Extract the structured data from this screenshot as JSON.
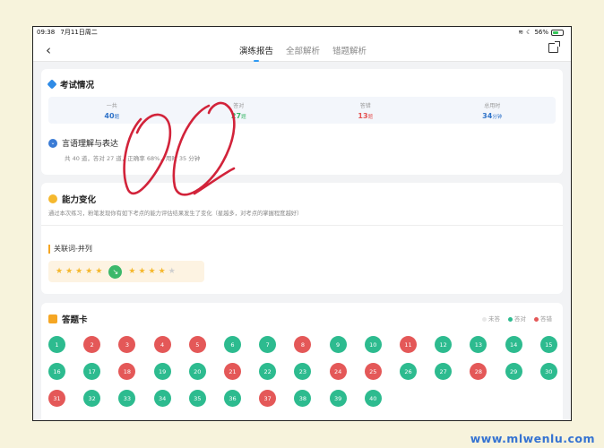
{
  "status": {
    "time": "09:38",
    "date": "7月11日周二",
    "battery": "56%",
    "battery_level": 0.56
  },
  "nav": {
    "back_glyph": "‹",
    "tabs": [
      {
        "label": "演练报告",
        "active": true
      },
      {
        "label": "全部解析",
        "active": false
      },
      {
        "label": "错题解析",
        "active": false
      }
    ]
  },
  "exam": {
    "title": "考试情况",
    "summary": [
      {
        "label": "一共",
        "value": "40",
        "unit": "题",
        "color": "#2f73c9"
      },
      {
        "label": "答对",
        "value": "27",
        "unit": "题",
        "color": "#3cb86a"
      },
      {
        "label": "答错",
        "value": "13",
        "unit": "题",
        "color": "#e45151"
      },
      {
        "label": "总用时",
        "value": "34",
        "unit": "分钟",
        "color": "#2f73c9"
      }
    ],
    "section_title": "言语理解与表达",
    "section_detail": "共 40 道，答对 27 道，正确率 68%，用时 35 分钟"
  },
  "ability": {
    "title": "能力变化",
    "description": "通过本次练习，粉笔发现你有如下考点的能力评估结果发生了变化（星越多，对考点的掌握程度越好）",
    "point_name": "关联词-并列",
    "before_stars": 5,
    "after_stars": 4,
    "max_stars": 5,
    "arrow_glyph": "↘"
  },
  "answer_card": {
    "title": "答题卡",
    "legend": [
      {
        "label": "未答",
        "color": "#e8e8e8"
      },
      {
        "label": "答对",
        "color": "#2dbb8f"
      },
      {
        "label": "答错",
        "color": "#e45858"
      }
    ],
    "colors": {
      "correct": "#2dbb8f",
      "wrong": "#e45858"
    },
    "questions": [
      {
        "n": "1",
        "s": "correct"
      },
      {
        "n": "2",
        "s": "wrong"
      },
      {
        "n": "3",
        "s": "wrong"
      },
      {
        "n": "4",
        "s": "wrong"
      },
      {
        "n": "5",
        "s": "wrong"
      },
      {
        "n": "6",
        "s": "correct"
      },
      {
        "n": "7",
        "s": "correct"
      },
      {
        "n": "8",
        "s": "wrong"
      },
      {
        "n": "9",
        "s": "correct"
      },
      {
        "n": "10",
        "s": "correct"
      },
      {
        "n": "11",
        "s": "wrong"
      },
      {
        "n": "12",
        "s": "correct"
      },
      {
        "n": "13",
        "s": "correct"
      },
      {
        "n": "14",
        "s": "correct"
      },
      {
        "n": "15",
        "s": "correct"
      },
      {
        "n": "16",
        "s": "correct"
      },
      {
        "n": "17",
        "s": "correct"
      },
      {
        "n": "18",
        "s": "wrong"
      },
      {
        "n": "19",
        "s": "correct"
      },
      {
        "n": "20",
        "s": "correct"
      },
      {
        "n": "21",
        "s": "wrong"
      },
      {
        "n": "22",
        "s": "correct"
      },
      {
        "n": "23",
        "s": "correct"
      },
      {
        "n": "24",
        "s": "wrong"
      },
      {
        "n": "25",
        "s": "wrong"
      },
      {
        "n": "26",
        "s": "correct"
      },
      {
        "n": "27",
        "s": "correct"
      },
      {
        "n": "28",
        "s": "wrong"
      },
      {
        "n": "29",
        "s": "correct"
      },
      {
        "n": "30",
        "s": "correct"
      },
      {
        "n": "31",
        "s": "wrong"
      },
      {
        "n": "32",
        "s": "correct"
      },
      {
        "n": "33",
        "s": "correct"
      },
      {
        "n": "34",
        "s": "correct"
      },
      {
        "n": "35",
        "s": "correct"
      },
      {
        "n": "36",
        "s": "correct"
      },
      {
        "n": "37",
        "s": "wrong"
      },
      {
        "n": "38",
        "s": "correct"
      },
      {
        "n": "39",
        "s": "correct"
      },
      {
        "n": "40",
        "s": "correct"
      }
    ]
  },
  "watermark": "www.mlwenlu.com"
}
